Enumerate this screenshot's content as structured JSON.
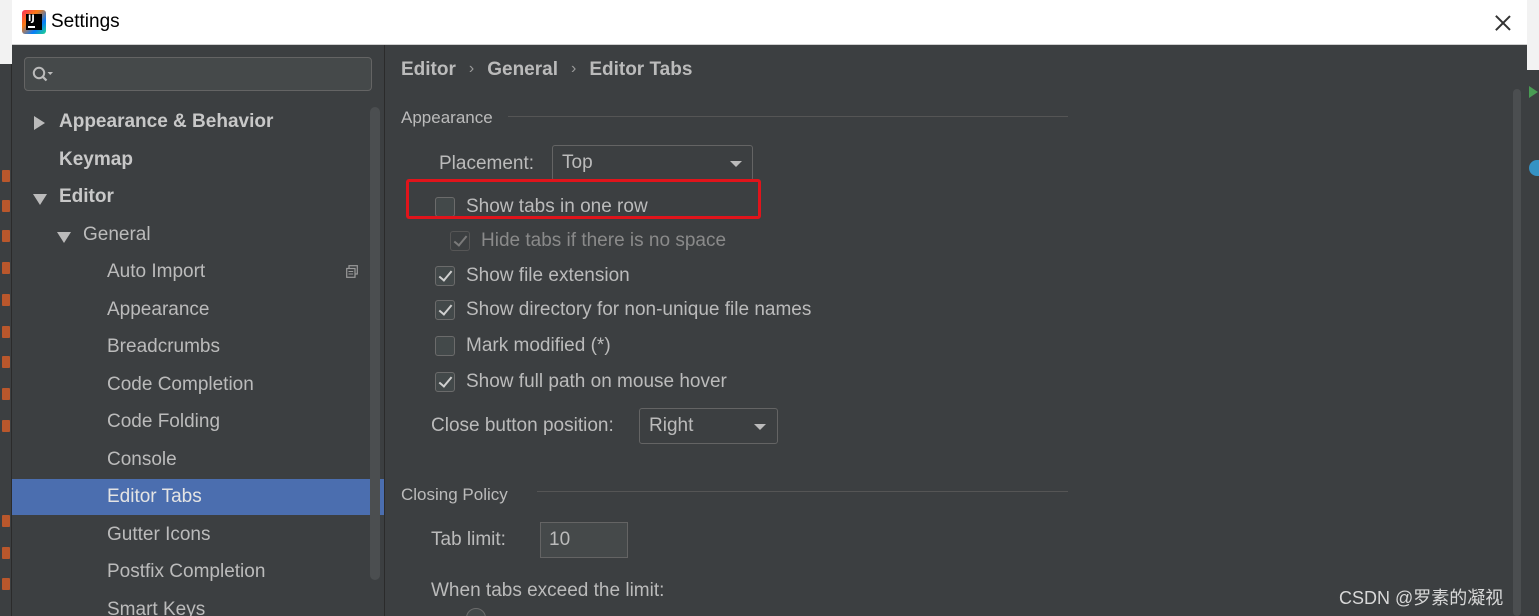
{
  "window": {
    "title": "Settings"
  },
  "sidebar": {
    "search_placeholder": "",
    "items": [
      {
        "label": "Appearance & Behavior",
        "level": 0,
        "expanded": false,
        "bold": true
      },
      {
        "label": "Keymap",
        "level": 0,
        "bold": true
      },
      {
        "label": "Editor",
        "level": 0,
        "expanded": true,
        "bold": true
      },
      {
        "label": "General",
        "level": 1,
        "expanded": true
      },
      {
        "label": "Auto Import",
        "level": 2
      },
      {
        "label": "Appearance",
        "level": 2
      },
      {
        "label": "Breadcrumbs",
        "level": 2
      },
      {
        "label": "Code Completion",
        "level": 2
      },
      {
        "label": "Code Folding",
        "level": 2
      },
      {
        "label": "Console",
        "level": 2
      },
      {
        "label": "Editor Tabs",
        "level": 2,
        "selected": true
      },
      {
        "label": "Gutter Icons",
        "level": 2
      },
      {
        "label": "Postfix Completion",
        "level": 2
      },
      {
        "label": "Smart Keys",
        "level": 2
      }
    ]
  },
  "breadcrumb": [
    "Editor",
    "General",
    "Editor Tabs"
  ],
  "breadcrumb_separator": "›",
  "appearance": {
    "section_title": "Appearance",
    "placement_label": "Placement:",
    "placement_value": "Top",
    "options": [
      {
        "label": "Show tabs in one row",
        "checked": false,
        "disabled": false
      },
      {
        "label": "Hide tabs if there is no space",
        "checked": true,
        "disabled": true
      },
      {
        "label": "Show file extension",
        "checked": true,
        "disabled": false
      },
      {
        "label": "Show directory for non-unique file names",
        "checked": true,
        "disabled": false
      },
      {
        "label": "Mark modified (*)",
        "checked": false,
        "disabled": false
      },
      {
        "label": "Show full path on mouse hover",
        "checked": true,
        "disabled": false
      }
    ],
    "close_button_label": "Close button position:",
    "close_button_value": "Right"
  },
  "closing_policy": {
    "section_title": "Closing Policy",
    "tab_limit_label": "Tab limit:",
    "tab_limit_value": "10",
    "exceed_label": "When tabs exceed the limit:"
  },
  "watermark": "CSDN @罗素的凝视",
  "colors": {
    "background": "#3c3f41",
    "selection": "#4b6eaf",
    "highlight": "#e0141b"
  }
}
